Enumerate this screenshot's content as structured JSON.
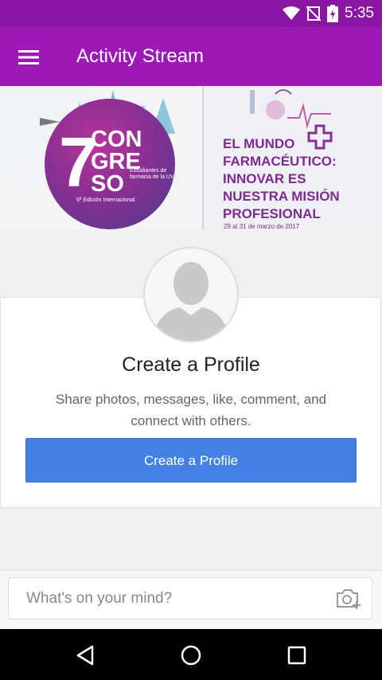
{
  "status_bar": {
    "time": "5:35",
    "icons": [
      "wifi-icon",
      "no-sim-icon",
      "battery-charging-icon"
    ]
  },
  "app_bar": {
    "menu_icon": "menu-icon",
    "title": "Activity Stream"
  },
  "banner": {
    "left": {
      "number": "7",
      "words": [
        "CON",
        "GRE",
        "SO"
      ],
      "subtitle": "Estudiantes de farmacia de la UV",
      "edition": "5ª Edición Internacional"
    },
    "right": {
      "headline": [
        "EL MUNDO",
        "FARMACÉUTICO:",
        "INNOVAR ES",
        "NUESTRA MISIÓN",
        "PROFESIONAL"
      ],
      "dates": "29 al 31 de marzo de 2017"
    }
  },
  "profile_card": {
    "title": "Create a Profile",
    "description": "Share photos, messages, like, comment, and connect with others.",
    "button_label": "Create a Profile"
  },
  "composer": {
    "placeholder": "What's on your mind?",
    "camera_icon": "camera-add-icon"
  },
  "nav_bar": {
    "buttons": [
      "back-icon",
      "home-icon",
      "recents-icon"
    ]
  },
  "colors": {
    "status_bar": "#8a15a3",
    "app_bar": "#9c19b5",
    "primary_button": "#4381e5",
    "banner_purple": "#7d2b8e"
  }
}
